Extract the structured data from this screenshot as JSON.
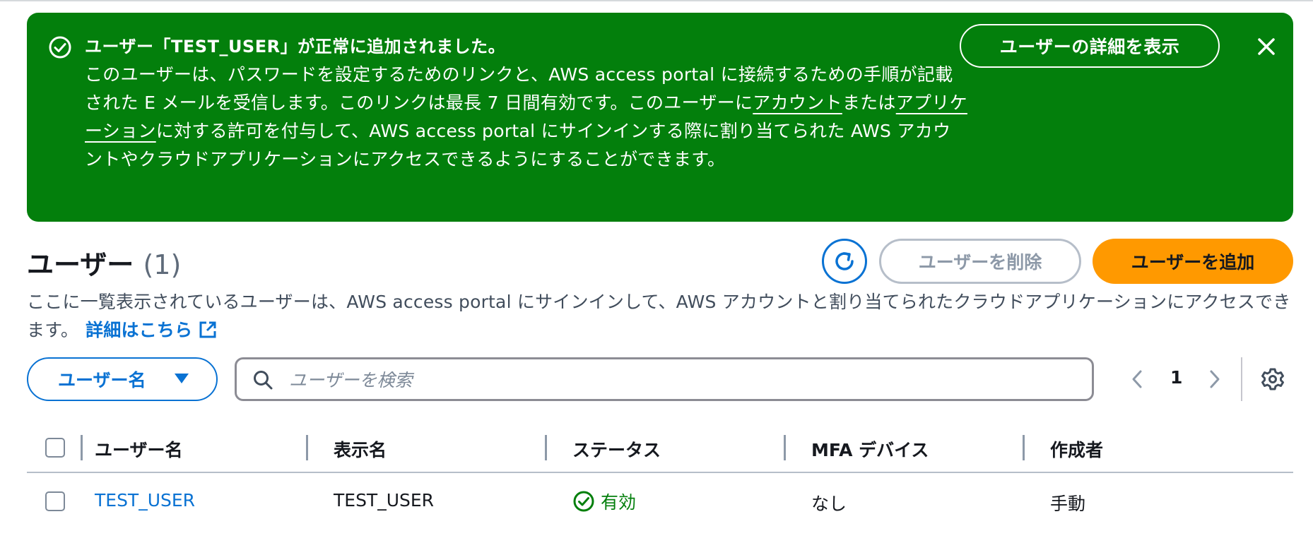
{
  "flash": {
    "title": "ユーザー「TEST_USER」が正常に追加されました。",
    "body_1": "このユーザーは、パスワードを設定するためのリンクと、AWS access portal に接続するための手順が記載された E メールを受信します。このリンクは最長 7 日間有効です。このユーザーに",
    "link_accounts": "アカウント",
    "body_2": "または",
    "link_apps": "アプリケーション",
    "body_3": "に対する許可を付与して、AWS access portal にサインインする際に割り当てられた AWS アカウントやクラウドアプリケーションにアクセスできるようにすることができます。",
    "view_button": "ユーザーの詳細を表示",
    "bg_color": "#037f0c"
  },
  "header": {
    "title": "ユーザー",
    "count": "(1)",
    "delete_button": "ユーザーを削除",
    "add_button": "ユーザーを追加",
    "description": "ここに一覧表示されているユーザーは、AWS access portal にサインインして、AWS アカウントと割り当てられたクラウドアプリケーションにアクセスできます。",
    "learn_more": "詳細はこちら"
  },
  "filter": {
    "property_label": "ユーザー名",
    "search_placeholder": "ユーザーを検索",
    "current_page": "1"
  },
  "table": {
    "columns": [
      "ユーザー名",
      "表示名",
      "ステータス",
      "MFA デバイス",
      "作成者"
    ],
    "rows": [
      {
        "username": "TEST_USER",
        "display_name": "TEST_USER",
        "status": "有効",
        "mfa": "なし",
        "created_by": "手動"
      }
    ]
  },
  "colors": {
    "accent": "#0972d3",
    "primary_button": "#ff9900",
    "success": "#037f0c"
  }
}
